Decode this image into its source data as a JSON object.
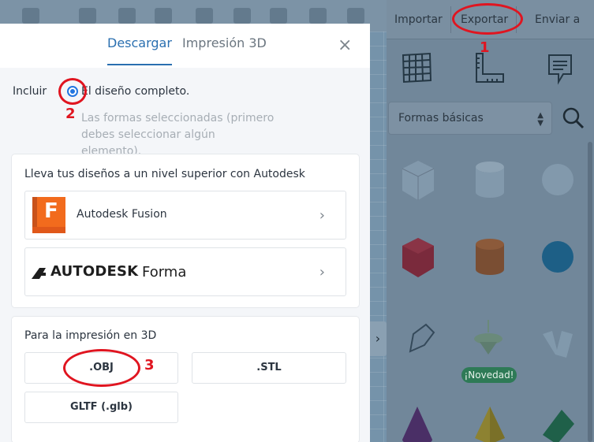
{
  "workspace": {
    "header_buttons": [
      "Importar",
      "Exportar",
      "Enviar a"
    ],
    "shape_category": "Formas básicas",
    "new_badge": "¡Novedad!",
    "side_tab_glyph": "›"
  },
  "modal": {
    "tabs": [
      "Descargar",
      "Impresión 3D"
    ],
    "active_tab": "Descargar",
    "close_glyph": "×",
    "include_label": "Incluir",
    "option_full": "El diseño completo.",
    "option_selected": "Las formas seleccionadas (primero debes seleccionar algún elemento).",
    "autodesk_card": {
      "title": "Lleva tus diseños a un nivel superior con Autodesk",
      "fusion_name": "Autodesk Fusion",
      "fusion_logo_letter": "F",
      "forma_brand": "AUTODESK",
      "forma_product": "Forma",
      "chevron": "›"
    },
    "print_card": {
      "title": "Para la impresión en 3D",
      "buttons": [
        ".OBJ",
        ".STL",
        "GLTF (.glb)"
      ]
    }
  },
  "annotations": [
    "1",
    "2",
    "3"
  ],
  "colors": {
    "accent": "#2a6fb0",
    "radio": "#2176e0",
    "annotation": "#e01520",
    "fusion_orange": "#f26b1d"
  }
}
